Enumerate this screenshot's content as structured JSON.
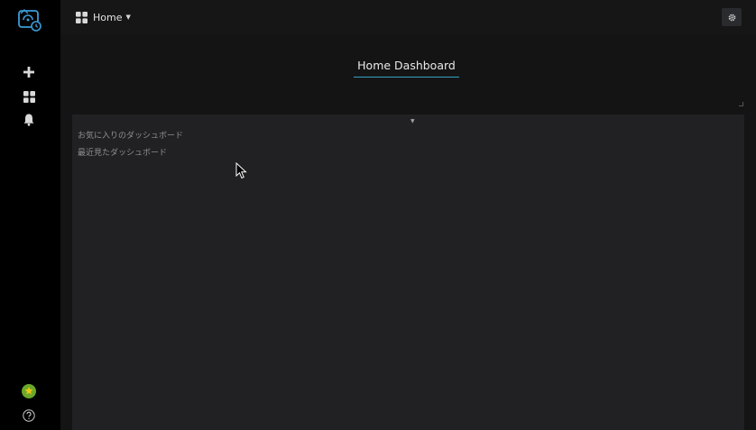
{
  "sidebar": {
    "logo_icon": "grafana-logo-icon",
    "items": [
      {
        "name": "create",
        "icon": "plus-icon"
      },
      {
        "name": "dashboards",
        "icon": "grid-icon"
      },
      {
        "name": "alerting",
        "icon": "bell-icon"
      }
    ],
    "bottom": [
      {
        "name": "profile",
        "icon": "avatar-icon"
      },
      {
        "name": "help",
        "icon": "help-icon"
      }
    ]
  },
  "navbar": {
    "dashboard_picker_label": "Home",
    "settings_icon": "gear-icon"
  },
  "dashboard": {
    "title": "Home Dashboard"
  },
  "panel": {
    "links": [
      {
        "label": "お気に入りのダッシュボード"
      },
      {
        "label": "最近見たダッシュボード"
      }
    ]
  },
  "colors": {
    "accent": "#33a2c4",
    "logo": "#3c9bd6"
  }
}
